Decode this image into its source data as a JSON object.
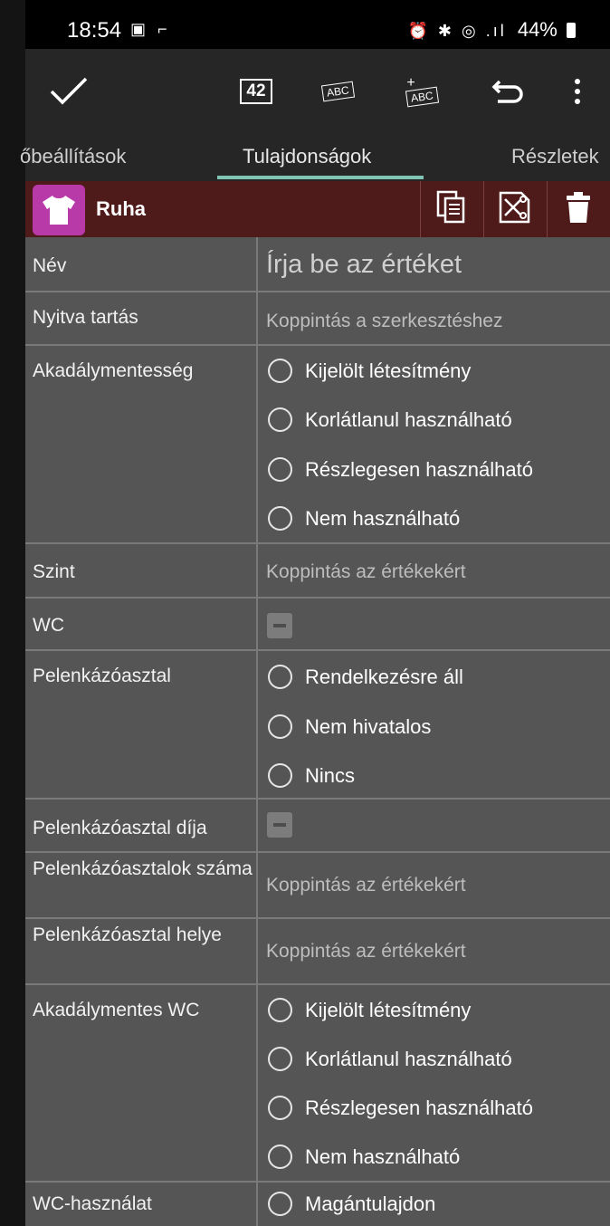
{
  "status_bar": {
    "time": "18:54",
    "left_icons": "▣ ⌐",
    "right_icons": "⏰ ✱ ◎ .ıl",
    "battery": "44%"
  },
  "toolbar": {
    "count": "42",
    "abc_label": "ABC",
    "abc_plus_label": "ABC",
    "abc_plus_sign": "+"
  },
  "tabs": [
    "őbeállítások",
    "Tulajdonságok",
    "Részletek"
  ],
  "category": {
    "name": "Ruha",
    "icon_color": "#b83aa8"
  },
  "rows": [
    {
      "label": "Név",
      "placeholder": "Írja be az értéket"
    },
    {
      "label": "Nyitva tartás",
      "hint": "Koppintás a szerkesztéshez"
    },
    {
      "label": "Akadálymentesség",
      "options": [
        "Kijelölt létesítmény",
        "Korlátlanul használható",
        "Részlegesen használható",
        "Nem használható"
      ]
    },
    {
      "label": "Szint",
      "hint": "Koppintás az értékekért"
    },
    {
      "label": "WC"
    },
    {
      "label": "Pelenkázóasztal",
      "options": [
        "Rendelkezésre áll",
        "Nem hivatalos",
        "Nincs"
      ]
    },
    {
      "label": "Pelenkázóasztal díja"
    },
    {
      "label": "Pelenkázóasztalok száma",
      "hint": "Koppintás az értékekért"
    },
    {
      "label": "Pelenkázóasztal helye",
      "hint": "Koppintás az értékekért"
    },
    {
      "label": "Akadálymentes WC",
      "options": [
        "Kijelölt létesítmény",
        "Korlátlanul használható",
        "Részlegesen használható",
        "Nem használható"
      ]
    },
    {
      "label": "WC-használat",
      "options": [
        "Magántulajdon"
      ]
    }
  ]
}
